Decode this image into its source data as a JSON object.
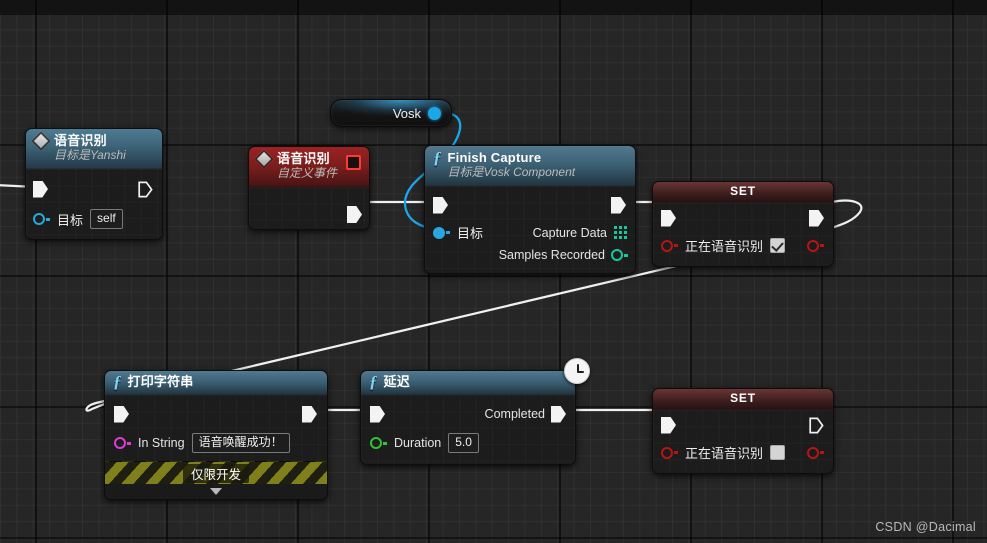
{
  "app": {
    "name": "Unreal Engine Blueprint Editor",
    "watermark": "CSDN @Dacimal"
  },
  "canvas": {
    "background_color": "#262626",
    "grid_color": "#2f2f2f",
    "wire_color": "#ffffff",
    "data_wire_color": "#19a7e8"
  },
  "nodes": {
    "speech_event": {
      "title": "语音识别",
      "subtitle": "目标是Yanshi",
      "icon": "event-diamond-icon",
      "header_color": "#3d6377",
      "exec_out_label": "",
      "pins": [
        {
          "label": "目标",
          "value": "self",
          "pin_color": "#29a7e0",
          "kind": "object"
        }
      ]
    },
    "custom_event": {
      "title": "语音识别",
      "subtitle": "自定义事件",
      "icon": "custom-event-icon",
      "header_color": "#7a1d1d",
      "badge": "stop-icon"
    },
    "vosk_variable": {
      "label": "Vosk",
      "pin_color": "#19a7e8"
    },
    "finish_capture": {
      "title": "Finish Capture",
      "subtitle": "目标是Vosk Component",
      "icon": "function-f-icon",
      "header_color": "#3b5e72",
      "inputs": [
        {
          "label": "目标",
          "pin_color": "#29a7e0",
          "kind": "object"
        }
      ],
      "outputs": [
        {
          "label": "Capture Data",
          "pin_color": "#14c9a0",
          "kind": "array"
        },
        {
          "label": "Samples Recorded",
          "pin_color": "#14c9a0",
          "kind": "struct"
        }
      ]
    },
    "set_recording_true": {
      "title": "SET",
      "header_color": "#401f1f",
      "property_label": "正在语音识别",
      "property_value": true,
      "pin_color": "#b31616"
    },
    "set_recording_false": {
      "title": "SET",
      "header_color": "#401f1f",
      "property_label": "正在语音识别",
      "property_value": false,
      "pin_color": "#b31616"
    },
    "print_string": {
      "title": "打印字符串",
      "icon": "function-f-icon",
      "header_color": "#3b5e72",
      "inputs": [
        {
          "label": "In String",
          "value": "语音唤醒成功！",
          "pin_color": "#e03ad6",
          "kind": "string"
        }
      ],
      "footer_note": "仅限开发",
      "expander": "chevron-down-icon"
    },
    "delay": {
      "title": "延迟",
      "icon": "function-f-icon",
      "header_color": "#3b5e72",
      "badge": "clock-icon",
      "outputs": [
        {
          "label": "Completed",
          "kind": "exec"
        }
      ],
      "inputs": [
        {
          "label": "Duration",
          "value": "5.0",
          "pin_color": "#33c23a",
          "kind": "float"
        }
      ]
    }
  }
}
